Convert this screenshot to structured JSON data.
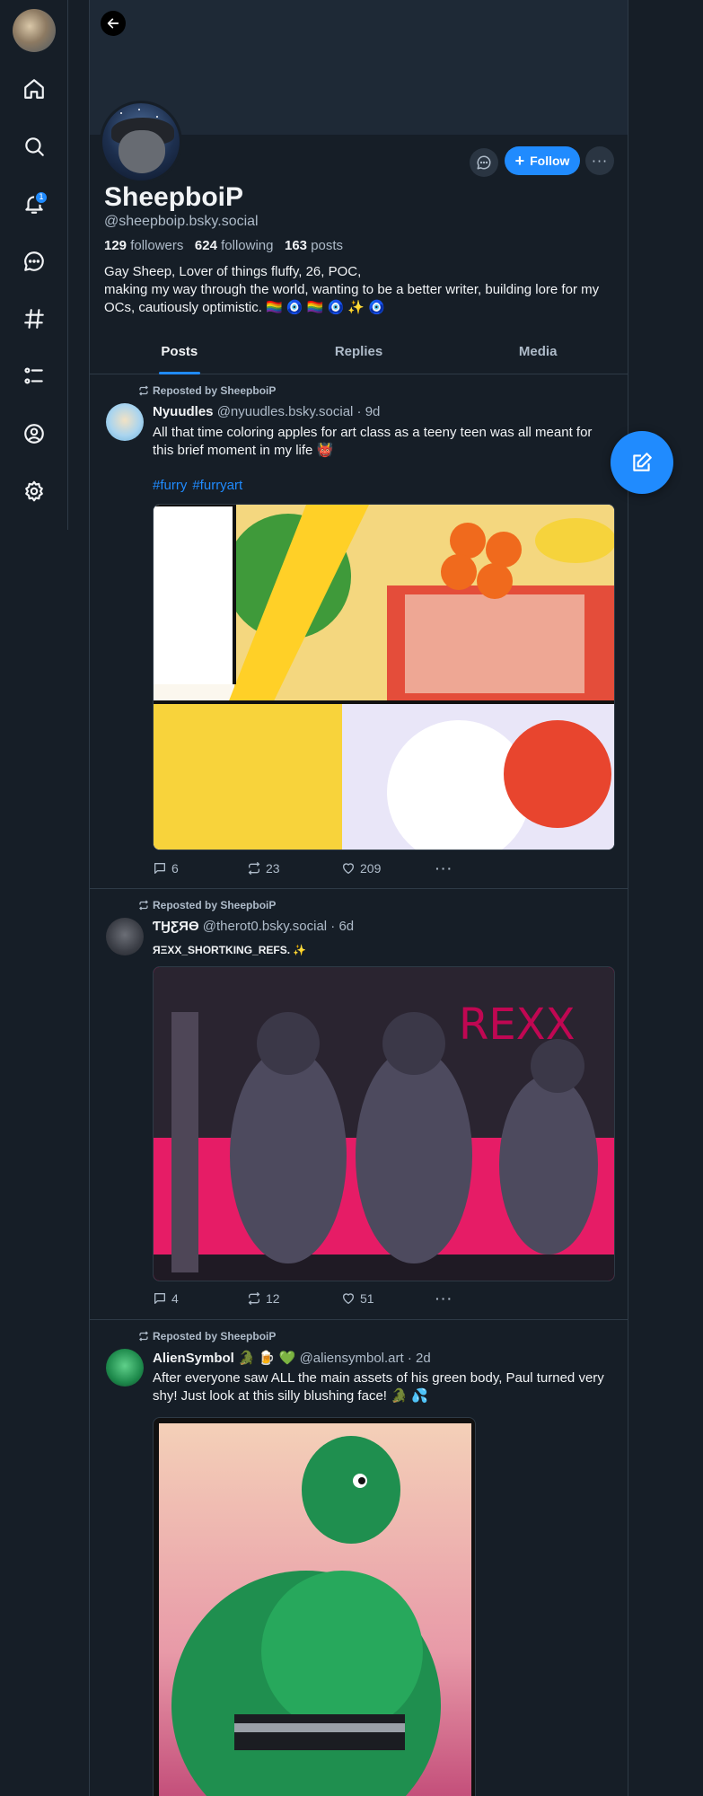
{
  "sidebar": {
    "items": [
      {
        "icon": "home-icon"
      },
      {
        "icon": "search-icon"
      },
      {
        "icon": "bell-icon",
        "badge": "1"
      },
      {
        "icon": "chat-icon"
      },
      {
        "icon": "hashtag-icon"
      },
      {
        "icon": "list-icon"
      },
      {
        "icon": "profile-icon"
      },
      {
        "icon": "gear-icon"
      }
    ]
  },
  "profile": {
    "display_name": "SheepboiP",
    "handle": "@sheepboip.bsky.social",
    "followers_count": "129",
    "followers_label": "followers",
    "following_count": "624",
    "following_label": "following",
    "posts_count": "163",
    "posts_label": "posts",
    "bio": "Gay Sheep, Lover of things fluffy, 26, POC,\nmaking my way through the world, wanting to be a better writer, building lore for my OCs, cautiously optimistic. 🏳️‍🌈 🧿 🏳️‍🌈 🧿 ✨ 🧿",
    "follow_label": "Follow"
  },
  "tabs": [
    {
      "label": "Posts",
      "active": true
    },
    {
      "label": "Replies",
      "active": false
    },
    {
      "label": "Media",
      "active": false
    }
  ],
  "posts": [
    {
      "repost_label": "Reposted by SheepboiP",
      "author": "Nyuudles",
      "handle": "@nyuudles.bsky.social",
      "time": "· 9d",
      "text": "All that time coloring apples for art class as a teeny teen was all meant for this brief moment in my life 👹",
      "hashtags": [
        "#furry",
        "#furryart"
      ],
      "replies": "6",
      "reposts": "23",
      "likes": "209"
    },
    {
      "repost_label": "Reposted by SheepboiP",
      "author": "ƬӇƸЯӨ",
      "handle": "@therot0.bsky.social",
      "time": "· 6d",
      "text": "ЯΞXX_SHORTKING_REFS. ✨",
      "replies": "4",
      "reposts": "12",
      "likes": "51"
    },
    {
      "repost_label": "Reposted by SheepboiP",
      "author": "AlienSymbol 🐊 🍺 💚",
      "handle": "@aliensymbol.art",
      "time": "· 2d",
      "text": "After everyone saw ALL the main assets of his green body, Paul turned very shy! Just look at this silly blushing face! 🐊 💦"
    }
  ],
  "colors": {
    "background": "#161e27",
    "accent": "#208bfe",
    "muted_text": "#aebbc9",
    "border": "#2e3a46"
  }
}
